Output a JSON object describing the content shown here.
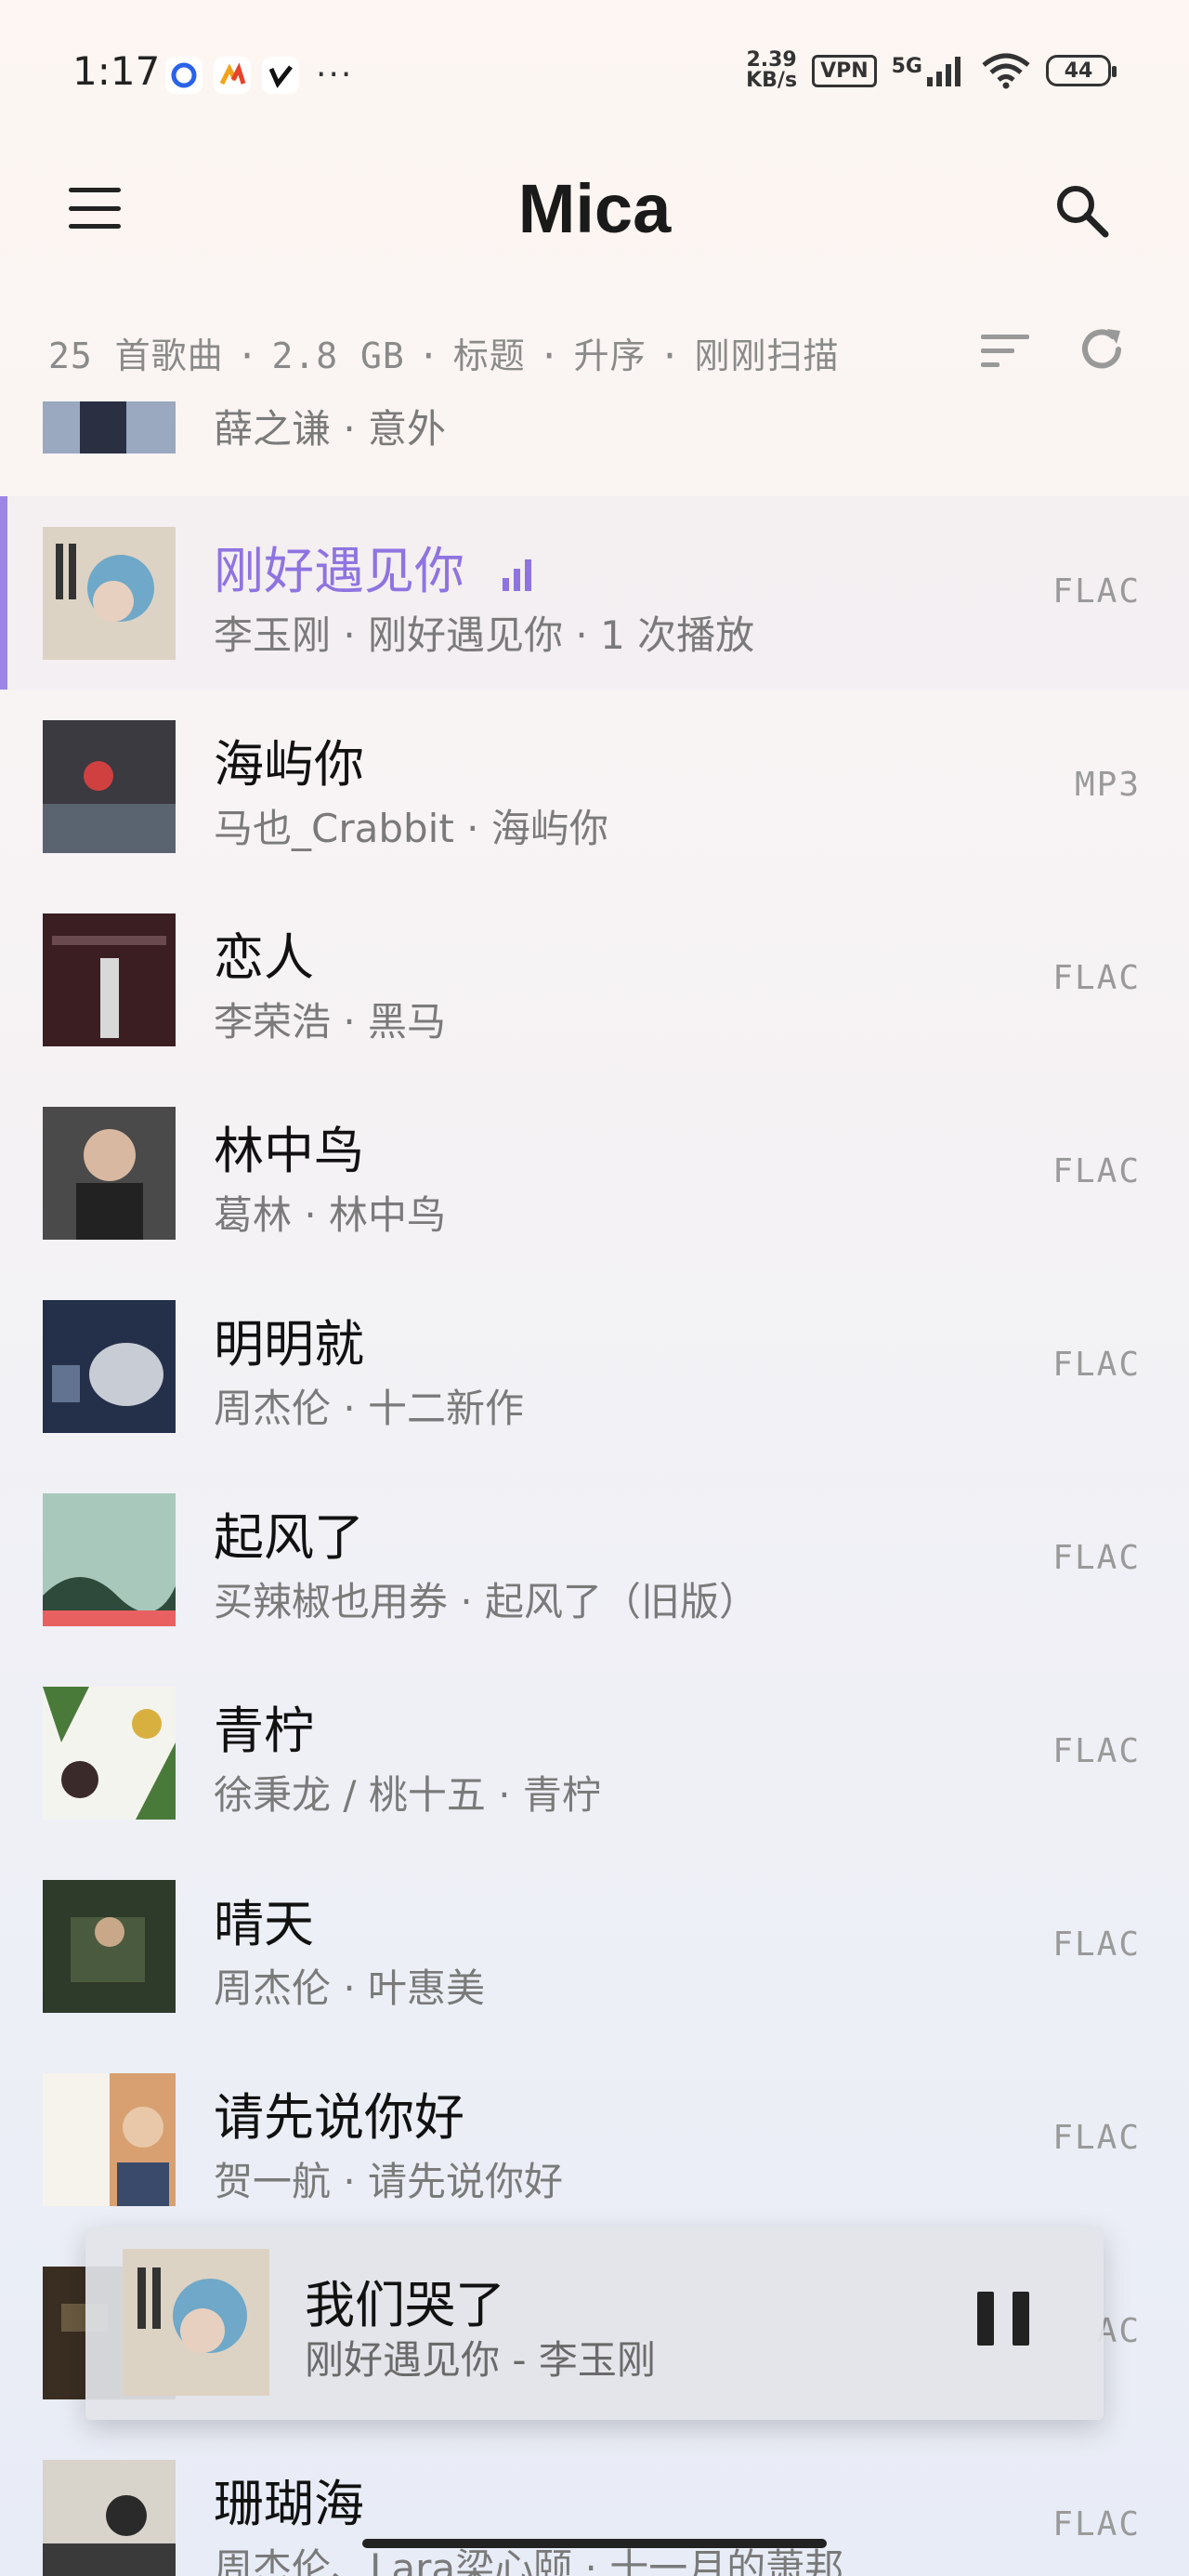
{
  "status_bar": {
    "time": "1:17",
    "app_icons": [
      "record-app-icon",
      "stats-app-icon",
      "check-app-icon"
    ],
    "more": "···",
    "speed_value": "2.39",
    "speed_unit": "KB/s",
    "vpn": "VPN",
    "network": "5G",
    "battery": "44"
  },
  "app_bar": {
    "title": "Mica"
  },
  "info_bar": {
    "count": "25 首歌曲",
    "size": "2.8 GB",
    "sort_field": "标题",
    "sort_order": "升序",
    "scan": "刚刚扫描",
    "separator": "·"
  },
  "songs": [
    {
      "title": "",
      "subtitle": "薛之谦 · 意外",
      "format": "",
      "active": false,
      "cover_color": "#4a5a78"
    },
    {
      "title": "刚好遇见你",
      "subtitle": "李玉刚 · 刚好遇见你 · 1 次播放",
      "format": "FLAC",
      "active": true,
      "cover_color": "#c9b9a8"
    },
    {
      "title": "海屿你",
      "subtitle": "马也_Crabbit · 海屿你",
      "format": "MP3",
      "active": false,
      "cover_color": "#3a3a40"
    },
    {
      "title": "恋人",
      "subtitle": "李荣浩 · 黑马",
      "format": "FLAC",
      "active": false,
      "cover_color": "#4a2a2e"
    },
    {
      "title": "林中鸟",
      "subtitle": "葛林 · 林中鸟",
      "format": "FLAC",
      "active": false,
      "cover_color": "#3c3c3c"
    },
    {
      "title": "明明就",
      "subtitle": "周杰伦 · 十二新作",
      "format": "FLAC",
      "active": false,
      "cover_color": "#2a3448"
    },
    {
      "title": "起风了",
      "subtitle": "买辣椒也用券 · 起风了（旧版）",
      "format": "FLAC",
      "active": false,
      "cover_color": "#8fb4a6"
    },
    {
      "title": "青柠",
      "subtitle": "徐秉龙 / 桃十五 · 青柠",
      "format": "FLAC",
      "active": false,
      "cover_color": "#6f9a5e"
    },
    {
      "title": "晴天",
      "subtitle": "周杰伦 · 叶惠美",
      "format": "FLAC",
      "active": false,
      "cover_color": "#3d4a36"
    },
    {
      "title": "请先说你好",
      "subtitle": "贺一航 · 请先说你好",
      "format": "FLAC",
      "active": false,
      "cover_color": "#d89a6a"
    },
    {
      "title": "",
      "subtitle": "",
      "format": "AC",
      "active": false,
      "cover_color": "#3a2e22"
    },
    {
      "title": "珊瑚海",
      "subtitle": "周杰伦、Lara梁心颐 · 十一月的萧邦",
      "format": "FLAC",
      "active": false,
      "cover_color": "#2a2a2a"
    }
  ],
  "mini_player": {
    "title": "我们哭了",
    "subtitle": "刚好遇见你 - 李玉刚"
  }
}
